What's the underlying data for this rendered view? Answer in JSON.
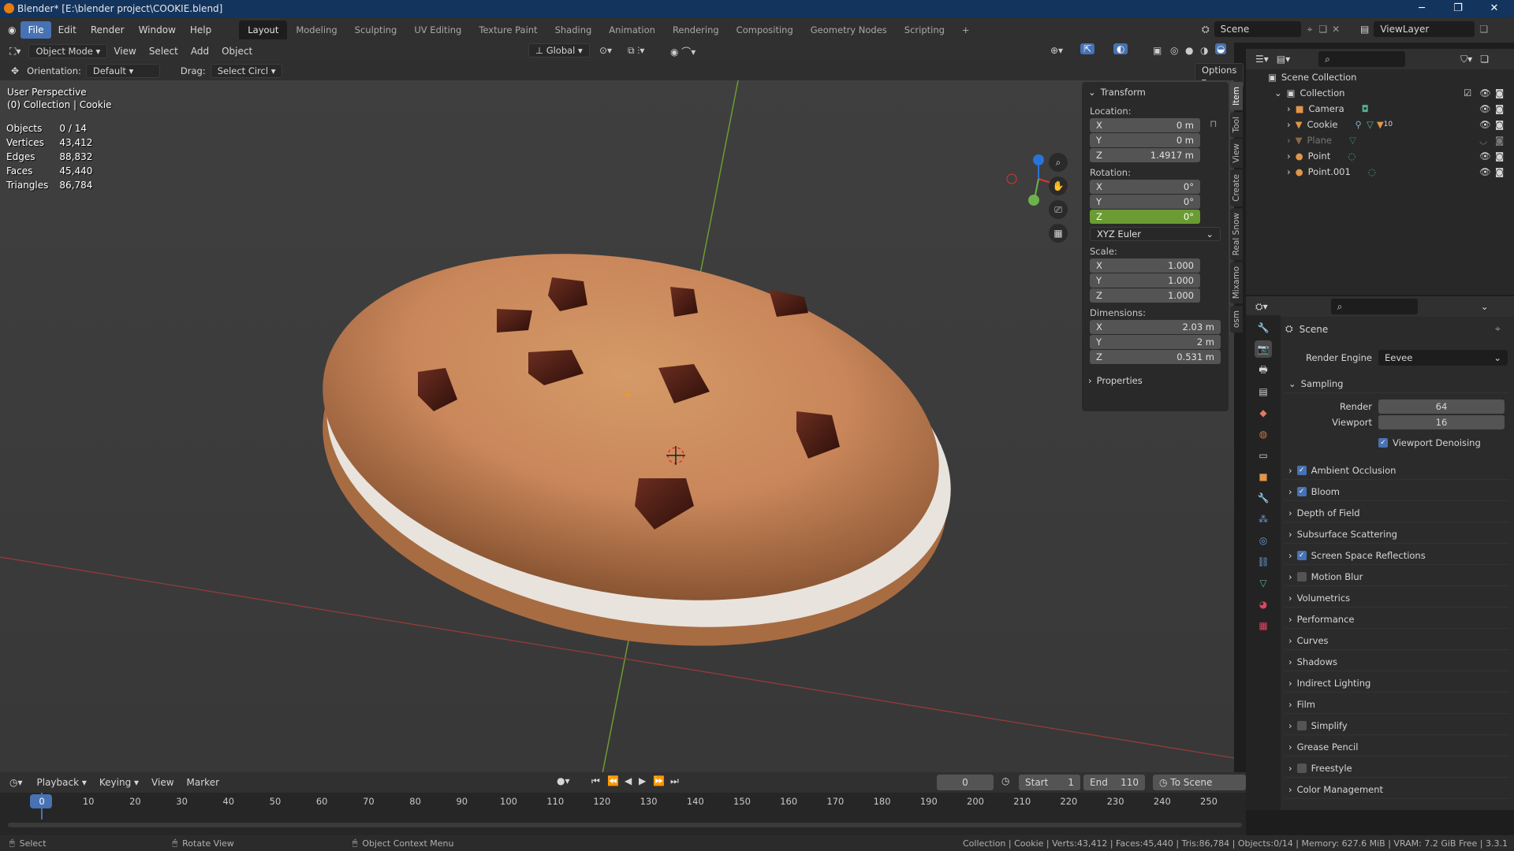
{
  "window": {
    "title": "Blender* [E:\\blender project\\COOKIE.blend]"
  },
  "menus": [
    "File",
    "Edit",
    "Render",
    "Window",
    "Help"
  ],
  "workspaces": [
    "Layout",
    "Modeling",
    "Sculpting",
    "UV Editing",
    "Texture Paint",
    "Shading",
    "Animation",
    "Rendering",
    "Compositing",
    "Geometry Nodes",
    "Scripting"
  ],
  "active_workspace": "Layout",
  "scene_field": "Scene",
  "viewlayer_field": "ViewLayer",
  "header3d": {
    "mode": "Object Mode",
    "view": "View",
    "select": "Select",
    "add": "Add",
    "object": "Object",
    "transform_orientation": "Global"
  },
  "toolheader": {
    "orientation_label": "Orientation:",
    "orientation_value": "Default",
    "drag_label": "Drag:",
    "drag_value": "Select Circl",
    "options": "Options"
  },
  "viewport": {
    "perspective": "User Perspective",
    "collection": "(0) Collection | Cookie",
    "stats": [
      [
        "Objects",
        "0 / 14"
      ],
      [
        "Vertices",
        "43,412"
      ],
      [
        "Edges",
        "88,832"
      ],
      [
        "Faces",
        "45,440"
      ],
      [
        "Triangles",
        "86,784"
      ]
    ]
  },
  "npanel": {
    "title": "Transform",
    "location_label": "Location:",
    "location": [
      [
        "X",
        "0 m"
      ],
      [
        "Y",
        "0 m"
      ],
      [
        "Z",
        "1.4917 m"
      ]
    ],
    "rotation_label": "Rotation:",
    "rotation": [
      [
        "X",
        "0°"
      ],
      [
        "Y",
        "0°"
      ],
      [
        "Z",
        "0°"
      ]
    ],
    "rotation_mode": "XYZ Euler",
    "scale_label": "Scale:",
    "scale": [
      [
        "X",
        "1.000"
      ],
      [
        "Y",
        "1.000"
      ],
      [
        "Z",
        "1.000"
      ]
    ],
    "dimensions_label": "Dimensions:",
    "dimensions": [
      [
        "X",
        "2.03 m"
      ],
      [
        "Y",
        "2 m"
      ],
      [
        "Z",
        "0.531 m"
      ]
    ],
    "properties": "Properties"
  },
  "sidetabs": [
    "Item",
    "Tool",
    "View",
    "Create",
    "Real Snow",
    "Mixamo",
    "osm"
  ],
  "outliner": {
    "root": "Scene Collection",
    "collection": "Collection",
    "items": [
      "Camera",
      "Cookie",
      "Plane",
      "Point",
      "Point.001"
    ],
    "cookie_mod_count": "10"
  },
  "props": {
    "context": "Scene",
    "render_engine_label": "Render Engine",
    "render_engine": "Eevee",
    "sampling": "Sampling",
    "render_label": "Render",
    "render_value": "64",
    "viewport_label": "Viewport",
    "viewport_value": "16",
    "denoise": "Viewport Denoising",
    "sections": [
      {
        "label": "Ambient Occlusion",
        "check": true
      },
      {
        "label": "Bloom",
        "check": true
      },
      {
        "label": "Depth of Field",
        "check": null
      },
      {
        "label": "Subsurface Scattering",
        "check": null
      },
      {
        "label": "Screen Space Reflections",
        "check": true
      },
      {
        "label": "Motion Blur",
        "check": false
      },
      {
        "label": "Volumetrics",
        "check": null
      },
      {
        "label": "Performance",
        "check": null
      },
      {
        "label": "Curves",
        "check": null
      },
      {
        "label": "Shadows",
        "check": null
      },
      {
        "label": "Indirect Lighting",
        "check": null
      },
      {
        "label": "Film",
        "check": null
      },
      {
        "label": "Simplify",
        "check": false
      },
      {
        "label": "Grease Pencil",
        "check": null
      },
      {
        "label": "Freestyle",
        "check": false
      },
      {
        "label": "Color Management",
        "check": null
      }
    ]
  },
  "timeline": {
    "menus": [
      "Playback",
      "Keying",
      "View",
      "Marker"
    ],
    "current_frame": "0",
    "start_label": "Start",
    "start": "1",
    "end_label": "End",
    "end": "110",
    "range_btn": "To Scene Range",
    "ticks": [
      "0",
      "10",
      "20",
      "30",
      "40",
      "50",
      "60",
      "70",
      "80",
      "90",
      "100",
      "110",
      "120",
      "130",
      "140",
      "150",
      "160",
      "170",
      "180",
      "190",
      "200",
      "210",
      "220",
      "230",
      "240",
      "250"
    ]
  },
  "statusbar": {
    "select": "Select",
    "rotate": "Rotate View",
    "context": "Object Context Menu",
    "info": "Collection | Cookie | Verts:43,412 | Faces:45,440 | Tris:86,784 | Objects:0/14 | Memory: 627.6 MiB | VRAM: 7.2 GiB Free | 3.3.1"
  },
  "colors": {
    "accent": "#4772b3",
    "title_bg": "#13345d",
    "active_field": "#6a9c33"
  }
}
